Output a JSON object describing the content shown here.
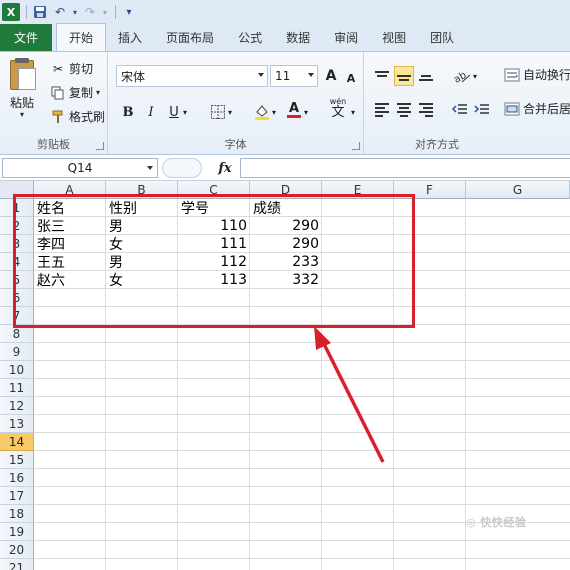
{
  "qat": {
    "undo": "↶",
    "redo": "↷"
  },
  "tabs": [
    {
      "label": "文件"
    },
    {
      "label": "开始"
    },
    {
      "label": "插入"
    },
    {
      "label": "页面布局"
    },
    {
      "label": "公式"
    },
    {
      "label": "数据"
    },
    {
      "label": "审阅"
    },
    {
      "label": "视图"
    },
    {
      "label": "团队"
    }
  ],
  "ribbon": {
    "clipboard": {
      "paste": "粘贴",
      "cut": "剪切",
      "copy": "复制",
      "format_painter": "格式刷",
      "label": "剪贴板"
    },
    "font": {
      "name": "宋体",
      "size": "11",
      "bold": "B",
      "italic": "I",
      "underline": "U",
      "label": "字体",
      "grow": "A",
      "shrink": "A",
      "color_a": "A",
      "phonetic": "wén"
    },
    "alignment": {
      "wrap": "自动换行",
      "merge": "合并后居中",
      "label": "对齐方式"
    }
  },
  "formula_bar": {
    "name_box": "Q14",
    "fx": "fx",
    "value": ""
  },
  "columns": [
    "A",
    "B",
    "C",
    "D",
    "E",
    "F",
    "G"
  ],
  "rows": [
    "1",
    "2",
    "3",
    "4",
    "5",
    "6",
    "7",
    "8",
    "9",
    "10",
    "11",
    "12",
    "13",
    "14",
    "15",
    "16",
    "17",
    "18",
    "19",
    "20",
    "21"
  ],
  "active_row": "14",
  "table": {
    "headers": [
      "姓名",
      "性别",
      "学号",
      "成绩"
    ],
    "rows": [
      [
        "张三",
        "男",
        "110",
        "290"
      ],
      [
        "李四",
        "女",
        "111",
        "290"
      ],
      [
        "王五",
        "男",
        "112",
        "233"
      ],
      [
        "赵六",
        "女",
        "113",
        "332"
      ]
    ]
  },
  "colors": {
    "file_tab": "#1f7a3c",
    "annotation": "#d8202b",
    "active_row": "#f8c967"
  }
}
